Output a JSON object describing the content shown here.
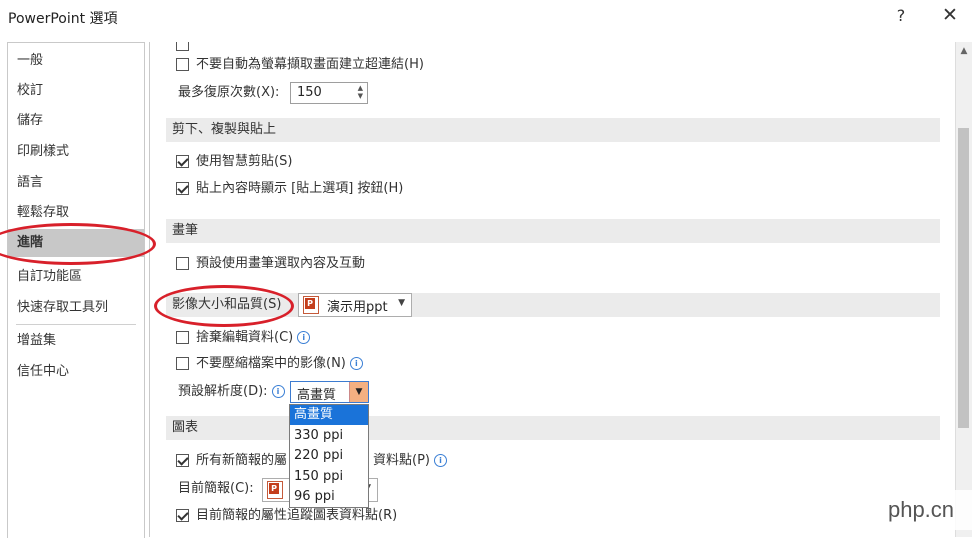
{
  "window": {
    "title": "PowerPoint 選項",
    "help": "?",
    "close": "✕"
  },
  "nav": {
    "items": [
      "一般",
      "校訂",
      "儲存",
      "印刷樣式",
      "語言",
      "輕鬆存取",
      "進階",
      "自訂功能區",
      "快速存取工具列",
      "增益集",
      "信任中心"
    ],
    "selected": "進階"
  },
  "content": {
    "top_rows": [
      {
        "label": "不要自動為螢幕擷取畫面建立超連結(H)",
        "checked": false
      }
    ],
    "undo": {
      "label": "最多復原次數(X):",
      "value": "150"
    },
    "section_cut": "剪下、複製與貼上",
    "cut_rows": [
      {
        "label": "使用智慧剪貼(S)",
        "checked": true
      },
      {
        "label": "貼上內容時顯示 [貼上選項] 按鈕(H)",
        "checked": true
      }
    ],
    "section_pen": "畫筆",
    "pen_rows": [
      {
        "label": "預設使用畫筆選取內容及互動",
        "checked": false
      }
    ],
    "section_image": "影像大小和品質(S)",
    "image_doc": "演示用ppt",
    "image_rows": [
      {
        "label": "捨棄編輯資料(C)",
        "checked": false
      },
      {
        "label": "不要壓縮檔案中的影像(N)",
        "checked": false
      }
    ],
    "resolution": {
      "label": "預設解析度(D):",
      "value": "高畫質"
    },
    "resolution_options": [
      "高畫質",
      "330 ppi",
      "220 ppi",
      "150 ppi",
      "96 ppi"
    ],
    "section_chart": "圖表",
    "chart_row1": {
      "label": "所有新簡報的屬",
      "label_tail": "資料點(P)",
      "checked": true
    },
    "chart_current": {
      "label": "目前簡報(C):"
    },
    "chart_row2": {
      "label": "目前簡報的屬性追蹤圖表資料點(R)",
      "checked": true
    }
  },
  "watermark": "php.cn"
}
